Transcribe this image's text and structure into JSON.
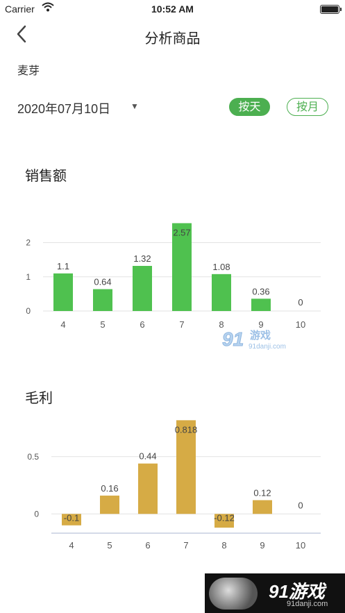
{
  "status_bar": {
    "carrier": "Carrier",
    "time": "10:52 AM"
  },
  "nav": {
    "title": "分析商品"
  },
  "product": {
    "name": "麦芽"
  },
  "date_filter": {
    "value": "2020年07月10日",
    "caret": "▼"
  },
  "modes": {
    "day": "按天",
    "month": "按月",
    "active": "day"
  },
  "colors": {
    "accent": "#4caf50",
    "sales_bar": "#4fc14f",
    "profit_bar": "#d6ab45"
  },
  "watermark": {
    "mid_text": "游戏",
    "mid_num": "91",
    "mid_url": "91danji.com",
    "corner_text": "91游戏",
    "corner_url": "91danji.com"
  },
  "chart_data": [
    {
      "type": "bar",
      "title": "销售额",
      "categories": [
        "4",
        "5",
        "6",
        "7",
        "8",
        "9",
        "10"
      ],
      "values": [
        1.1,
        0.64,
        1.32,
        2.57,
        1.08,
        0.36,
        0
      ],
      "value_labels": [
        "1.1",
        "0.64",
        "1.32",
        "2.57",
        "1.08",
        "0.36",
        "0"
      ],
      "yticks": [
        "0",
        "1",
        "2"
      ],
      "ylim": [
        0,
        2.6
      ],
      "grid": true,
      "color": "#4fc14f"
    },
    {
      "type": "bar",
      "title": "毛利",
      "categories": [
        "4",
        "5",
        "6",
        "7",
        "8",
        "9",
        "10"
      ],
      "values": [
        -0.1,
        0.16,
        0.44,
        0.818,
        -0.12,
        0.12,
        0
      ],
      "value_labels": [
        "-0.1",
        "0.16",
        "0.44",
        "0.818",
        "-0.12",
        "0.12",
        "0"
      ],
      "yticks": [
        "0",
        "0.5"
      ],
      "ylim": [
        -0.15,
        0.82
      ],
      "grid": true,
      "color": "#d6ab45"
    }
  ]
}
